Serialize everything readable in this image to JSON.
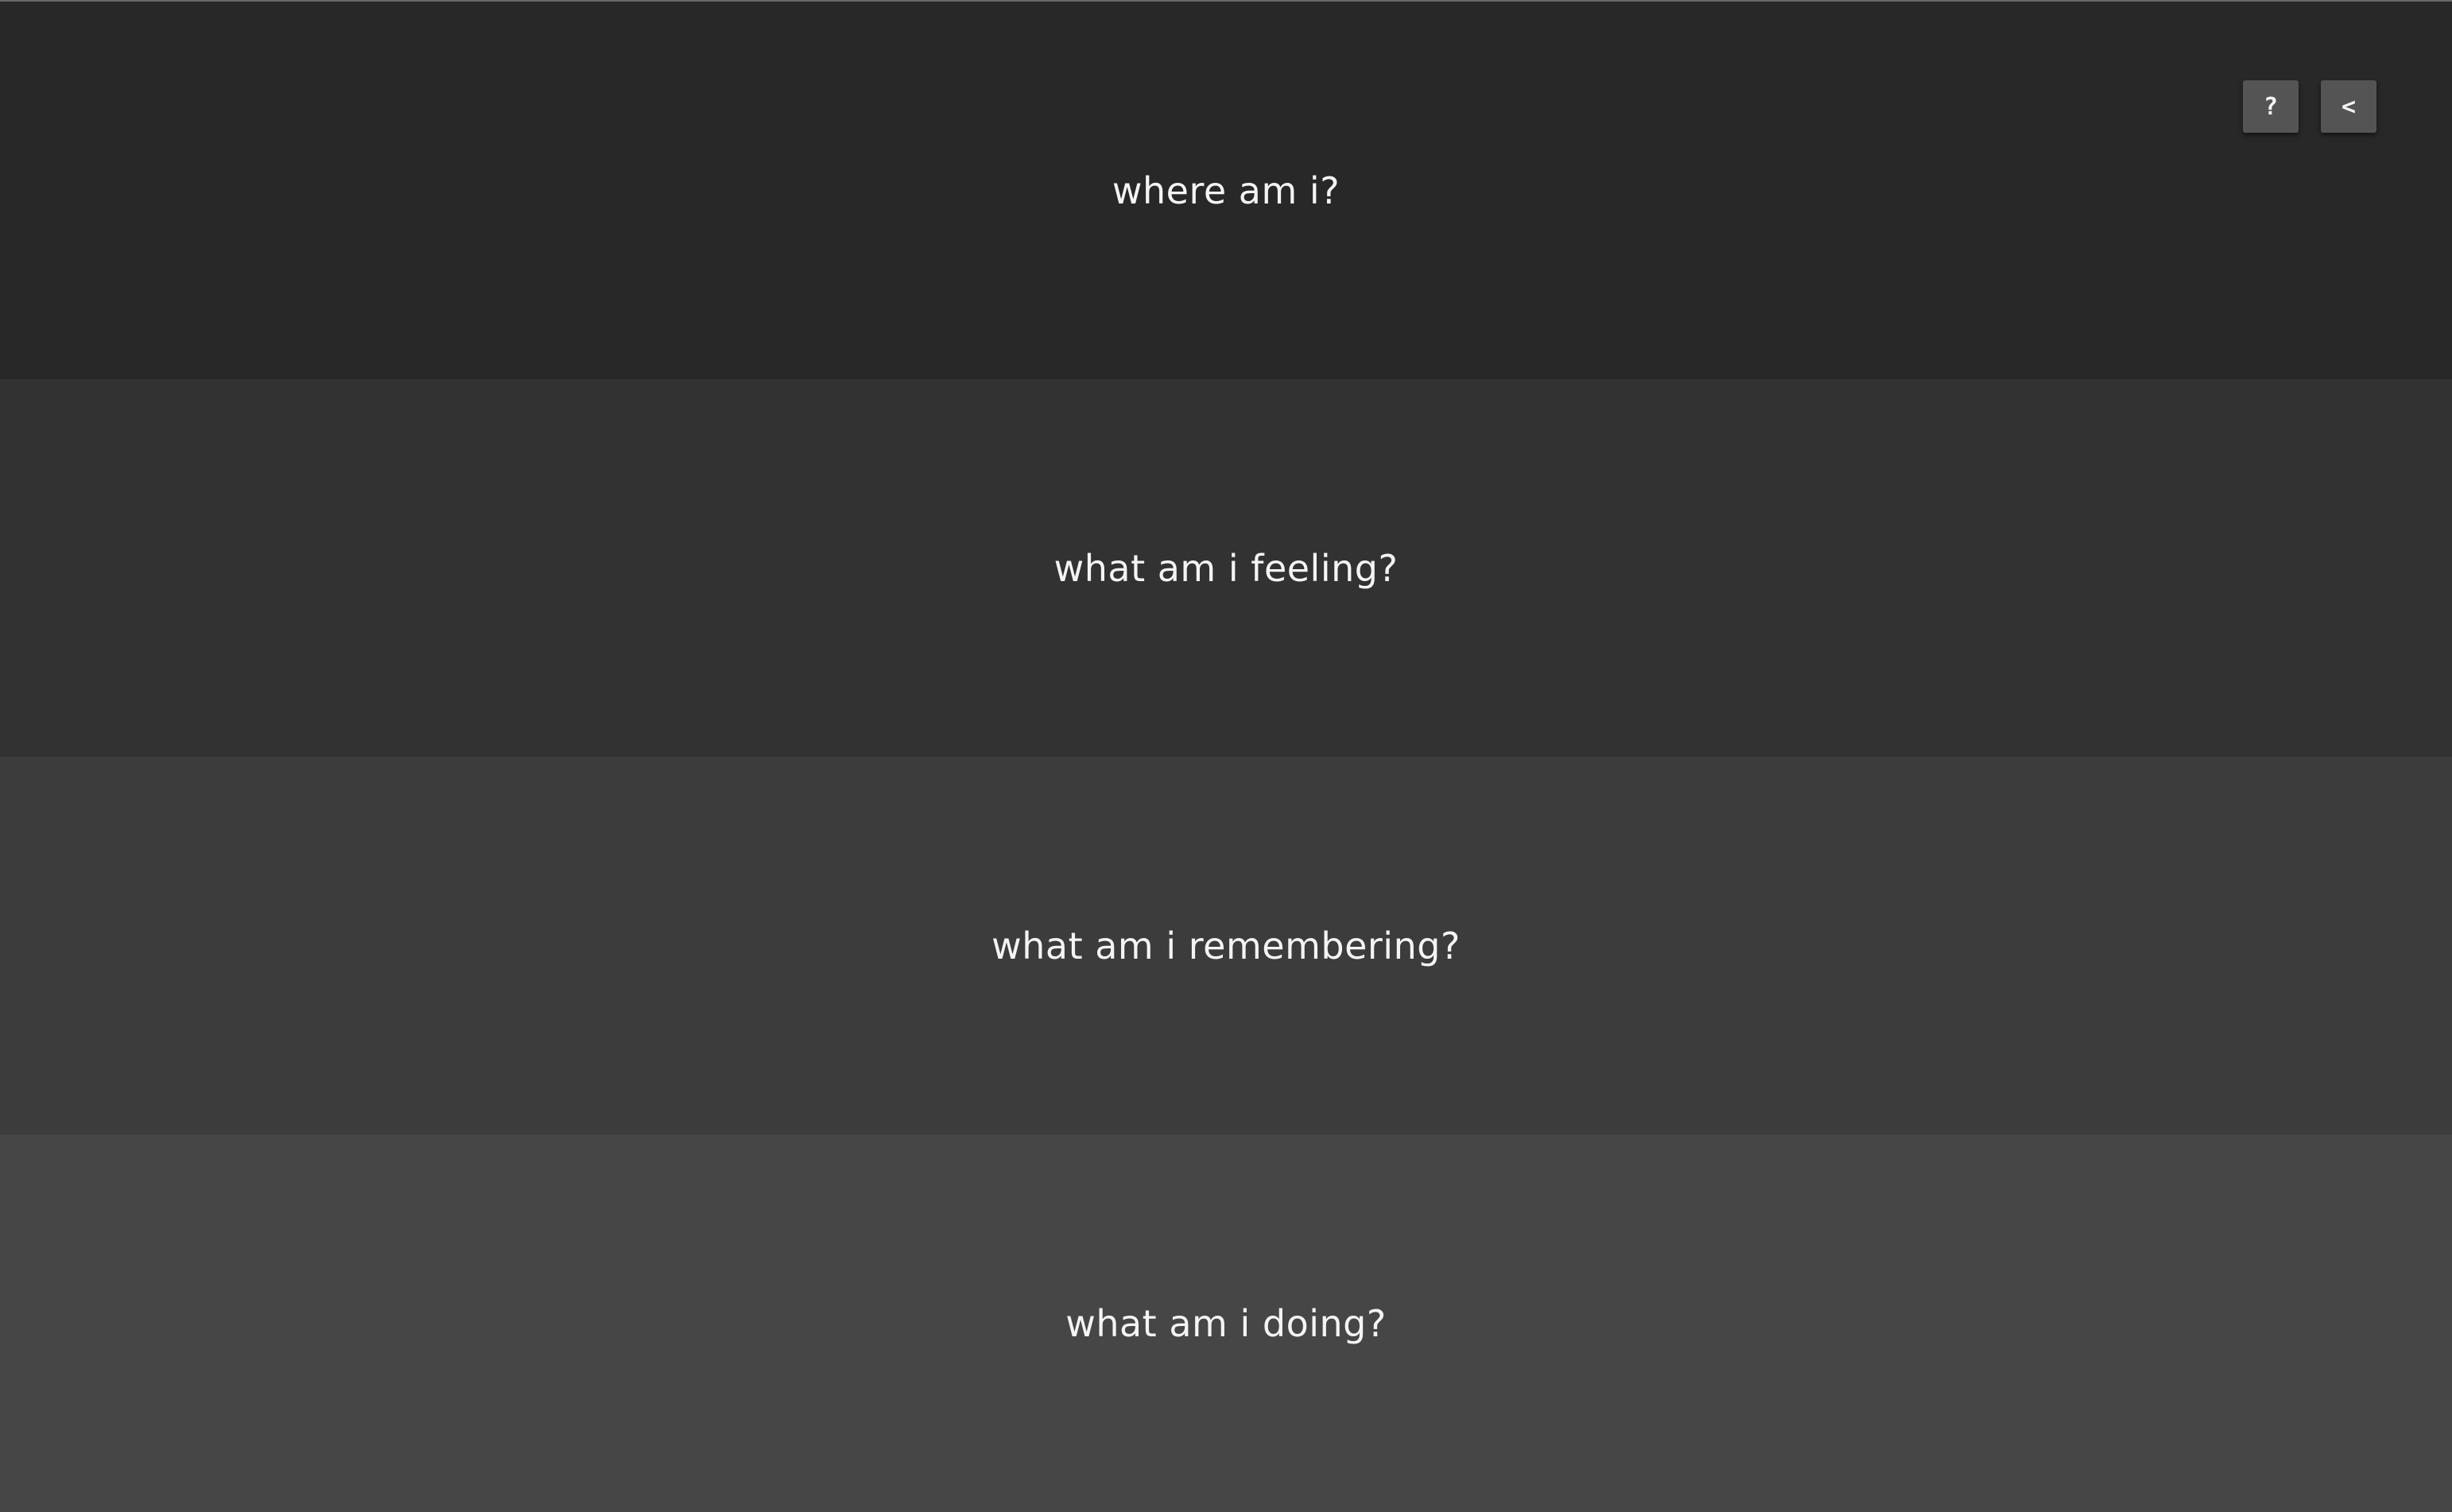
{
  "panels": [
    {
      "label": "where am i?",
      "color": "#282828"
    },
    {
      "label": "what am i feeling?",
      "color": "#323232"
    },
    {
      "label": "what am i remembering?",
      "color": "#3c3c3c"
    },
    {
      "label": "what am i doing?",
      "color": "#464646"
    }
  ],
  "controls": {
    "help": {
      "label": "?",
      "icon": "question-icon"
    },
    "back": {
      "label": "<",
      "icon": "chevron-left-icon"
    }
  },
  "colors": {
    "text": "#f4f4f4",
    "button_bg": "#545454"
  }
}
